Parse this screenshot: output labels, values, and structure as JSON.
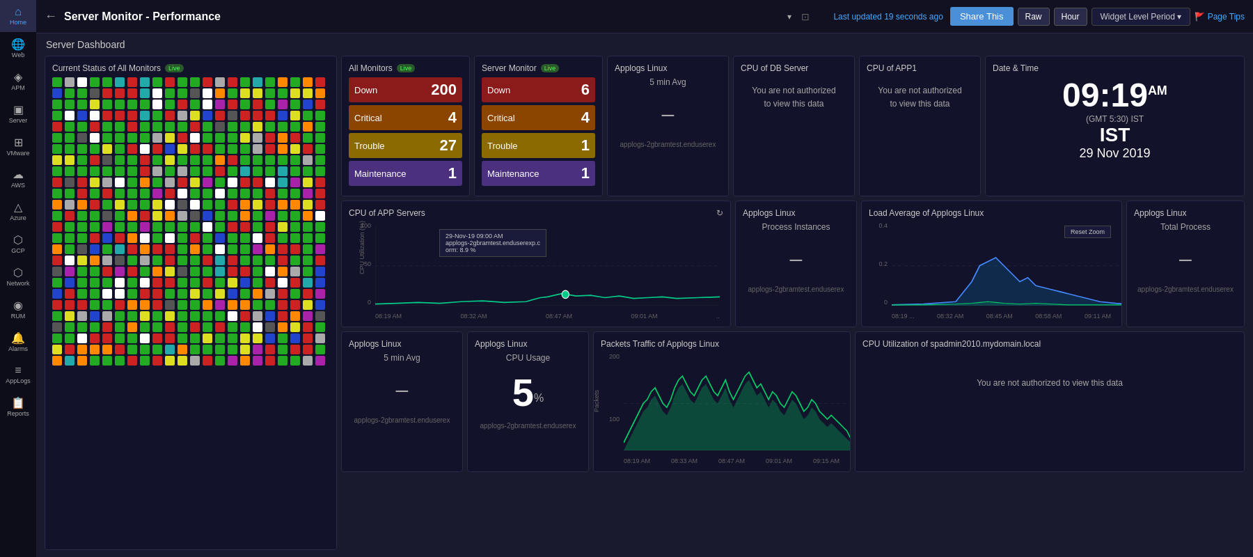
{
  "sidebar": {
    "items": [
      {
        "label": "Home",
        "icon": "⌂",
        "active": true
      },
      {
        "label": "Web",
        "icon": "🌐",
        "active": false
      },
      {
        "label": "APM",
        "icon": "📊",
        "active": false
      },
      {
        "label": "Server",
        "icon": "🖥",
        "active": false
      },
      {
        "label": "VMware",
        "icon": "▣",
        "active": false
      },
      {
        "label": "AWS",
        "icon": "☁",
        "active": false
      },
      {
        "label": "Azure",
        "icon": "△",
        "active": false
      },
      {
        "label": "GCP",
        "icon": "⬡",
        "active": false
      },
      {
        "label": "Network",
        "icon": "⬡",
        "active": false
      },
      {
        "label": "RUM",
        "icon": "◉",
        "active": false
      },
      {
        "label": "Alarms",
        "icon": "🔔",
        "active": false
      },
      {
        "label": "AppLogs",
        "icon": "📄",
        "active": false
      },
      {
        "label": "Reports",
        "icon": "📋",
        "active": false
      }
    ]
  },
  "topbar": {
    "back_icon": "←",
    "title": "Server Monitor - Performance",
    "updated_text": "Last updated",
    "updated_time": "19 seconds ago",
    "share_label": "Share This",
    "raw_label": "Raw",
    "hour_label": "Hour",
    "period_label": "Widget Level Period",
    "tips_label": "Page Tips"
  },
  "dashboard": {
    "title": "Server Dashboard",
    "current_status": {
      "title": "Current Status of All Monitors",
      "badge": "Live"
    },
    "all_monitors": {
      "title": "All Monitors",
      "badge": "Live",
      "rows": [
        {
          "label": "Down",
          "count": "200",
          "class": "status-down"
        },
        {
          "label": "Critical",
          "count": "4",
          "class": "status-critical"
        },
        {
          "label": "Trouble",
          "count": "27",
          "class": "status-trouble"
        },
        {
          "label": "Maintenance",
          "count": "1",
          "class": "status-maintenance"
        }
      ]
    },
    "server_monitor": {
      "title": "Server Monitor",
      "badge": "Live",
      "rows": [
        {
          "label": "Down",
          "count": "6",
          "class": "status-down"
        },
        {
          "label": "Critical",
          "count": "4",
          "class": "status-critical"
        },
        {
          "label": "Trouble",
          "count": "1",
          "class": "status-trouble"
        },
        {
          "label": "Maintenance",
          "count": "1",
          "class": "status-maintenance"
        }
      ]
    },
    "applogs_linux_1": {
      "title": "Applogs Linux",
      "subtitle": "5 min Avg",
      "value": "–",
      "source": "applogs-2gbramtest.enduserex"
    },
    "cpu_db_server": {
      "title": "CPU of DB Server",
      "message": "You are not authorized to view this data"
    },
    "cpu_app1": {
      "title": "CPU of APP1",
      "message": "You are not authorized to view this data"
    },
    "datetime": {
      "title": "Date & Time",
      "time": "09:19",
      "ampm": "AM",
      "gmt": "(GMT 5:30) IST",
      "timezone": "IST",
      "date": "29 Nov 2019"
    },
    "cpu_app_servers": {
      "title": "CPU of APP Servers",
      "y_labels": [
        "100",
        "50",
        "0"
      ],
      "y_axis_label": "CPU Utilization (%)",
      "x_labels": [
        "08:19 AM",
        "08:32 AM",
        "08:47 AM",
        "09:01 AM",
        ".."
      ],
      "tooltip": {
        "time": "29-Nov-19 09:00 AM",
        "host": "applogs-2gbramtest.enduserexp.c",
        "value": "orm: 8.9 %"
      }
    },
    "applogs_process": {
      "title": "Applogs Linux",
      "subtitle": "Process Instances",
      "value": "–",
      "source": "applogs-2gbramtest.enduserex"
    },
    "load_average": {
      "title": "Load Average of Applogs Linux",
      "reset_zoom": "Reset Zoom",
      "y_labels": [
        "0.4",
        "0.2",
        "0"
      ],
      "x_labels": [
        "08:19 ...",
        "08:32 AM",
        "08:45 AM",
        "08:58 AM",
        "09:11 AM"
      ]
    },
    "applogs_total": {
      "title": "Applogs Linux",
      "subtitle": "Total Process",
      "value": "–",
      "source": "applogs-2gbramtest.enduserex"
    },
    "applogs_5min": {
      "title": "Applogs Linux",
      "subtitle": "5 min Avg",
      "value": "–",
      "source": "applogs-2gbramtest.enduserex"
    },
    "applogs_cpu": {
      "title": "Applogs Linux",
      "subtitle": "CPU Usage",
      "value": "5",
      "unit": "%",
      "source": "applogs-2gbramtest.enduserex"
    },
    "packets_traffic": {
      "title": "Packets Traffic of Applogs Linux",
      "y_labels": [
        "200",
        "100"
      ],
      "y_axis_label": "Packets",
      "x_labels": [
        "08:19 AM",
        "08:33 AM",
        "08:47 AM",
        "09:01 AM",
        "09:15 AM"
      ]
    },
    "cpu_utilization": {
      "title": "CPU Utilization of spadmin2010.mydomain.local",
      "message": "You are not authorized to view this data"
    }
  },
  "colors": {
    "dot_colors": [
      "#22aa22",
      "#cc2222",
      "#ff8800",
      "#dddd00",
      "#ffffff",
      "#aaaaaa",
      "#2222cc",
      "#aa22aa"
    ],
    "down_bg": "#7B1111",
    "critical_bg": "#7B3A00",
    "trouble_bg": "#7B5A00",
    "maintenance_bg": "#3B2070",
    "chart_line": "#00cc88",
    "chart_line2": "#4488ff",
    "accent": "#4a90d9"
  }
}
